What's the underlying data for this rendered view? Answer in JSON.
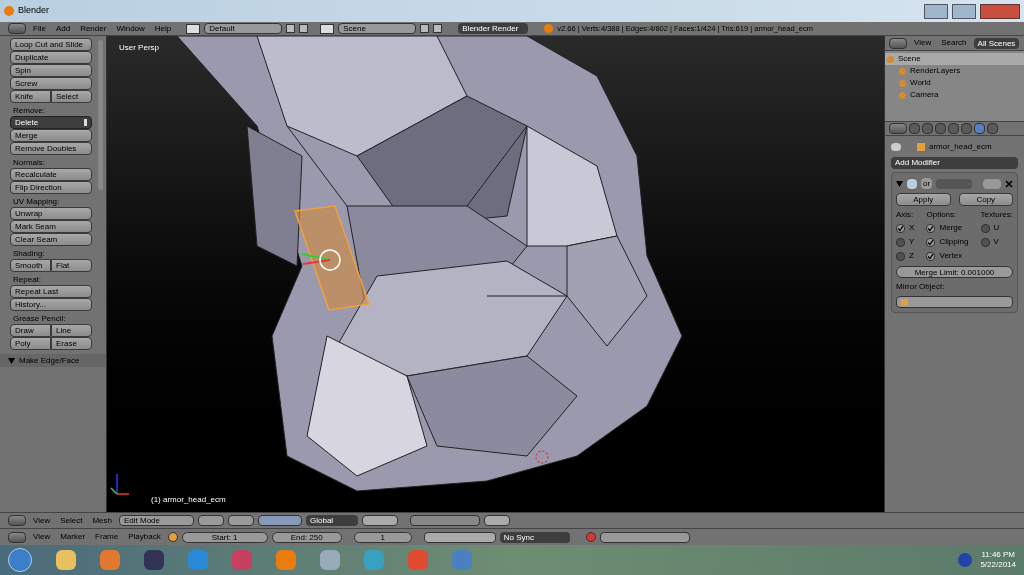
{
  "window": {
    "title": "Blender"
  },
  "info_header": {
    "menus": [
      "File",
      "Add",
      "Render",
      "Window",
      "Help"
    ],
    "layout": "Default",
    "scene": "Scene",
    "engine": "Blender Render",
    "stats": "v2.66 | Verts:4/388 | Edges:4/802 | Faces:1/424 | Tris:619 | armor_head_ecm"
  },
  "toolbar": [
    {
      "kind": "button",
      "label": "Loop Cut and Slide"
    },
    {
      "kind": "button",
      "label": "Duplicate"
    },
    {
      "kind": "button",
      "label": "Spin"
    },
    {
      "kind": "button",
      "label": "Screw"
    },
    {
      "kind": "pair",
      "labels": [
        "Knife",
        "Select"
      ]
    },
    {
      "kind": "label",
      "label": "Remove:"
    },
    {
      "kind": "dropdown",
      "label": "Delete"
    },
    {
      "kind": "button",
      "label": "Merge"
    },
    {
      "kind": "button",
      "label": "Remove Doubles"
    },
    {
      "kind": "label",
      "label": "Normals:"
    },
    {
      "kind": "button",
      "label": "Recalculate"
    },
    {
      "kind": "button",
      "label": "Flip Direction"
    },
    {
      "kind": "label",
      "label": "UV Mapping:"
    },
    {
      "kind": "button",
      "label": "Unwrap"
    },
    {
      "kind": "button",
      "label": "Mark Seam"
    },
    {
      "kind": "button",
      "label": "Clear Seam"
    },
    {
      "kind": "label",
      "label": "Shading:"
    },
    {
      "kind": "pair",
      "labels": [
        "Smooth",
        "Flat"
      ]
    },
    {
      "kind": "label",
      "label": "Repeat:"
    },
    {
      "kind": "button",
      "label": "Repeat Last"
    },
    {
      "kind": "button",
      "label": "History..."
    },
    {
      "kind": "label",
      "label": "Grease Pencil:"
    },
    {
      "kind": "pair",
      "labels": [
        "Draw",
        "Line"
      ]
    },
    {
      "kind": "pair",
      "labels": [
        "Poly",
        "Erase"
      ]
    }
  ],
  "last_operator": "Make Edge/Face",
  "viewport": {
    "view_name": "User Persp",
    "object_label": "(1) armor_head_ecm"
  },
  "outliner": {
    "menus": [
      "View",
      "Search"
    ],
    "filter": "All Scenes",
    "items": [
      {
        "label": "Scene",
        "selected": true,
        "children": [
          {
            "label": "RenderLayers",
            "selected": false
          },
          {
            "label": "World",
            "selected": false
          },
          {
            "label": "Camera",
            "selected": false
          }
        ]
      }
    ]
  },
  "properties": {
    "tabs": [
      {
        "selected": false
      },
      {
        "selected": false
      },
      {
        "selected": false
      },
      {
        "selected": false
      },
      {
        "selected": false
      },
      {
        "selected": true
      },
      {
        "selected": false
      }
    ],
    "object": "armor_head_ecm",
    "add_modifier": "Add Modifier",
    "modifier_name": "or",
    "apply": "Apply",
    "copy": "Copy",
    "columns": [
      {
        "title": "Axis:",
        "options": [
          {
            "label": "X",
            "checked": true
          },
          {
            "label": "Y",
            "checked": false
          },
          {
            "label": "Z",
            "checked": false
          }
        ]
      },
      {
        "title": "Options:",
        "options": [
          {
            "label": "Merge",
            "checked": true
          },
          {
            "label": "Clipping",
            "checked": true
          },
          {
            "label": "Vertex",
            "checked": true
          }
        ]
      },
      {
        "title": "Textures:",
        "options": [
          {
            "label": "U",
            "checked": false
          },
          {
            "label": "V",
            "checked": false
          }
        ]
      }
    ],
    "merge_limit": "Merge Limit: 0.001000",
    "mirror_object": "Mirror Object:"
  },
  "view3d_header": {
    "menus": [
      "View",
      "Select",
      "Mesh"
    ],
    "mode": "Edit Mode",
    "orientation": "Global"
  },
  "timeline_header": {
    "menus": [
      "View",
      "Marker",
      "Frame",
      "Playback"
    ],
    "start": "Start: 1",
    "end": "End: 250",
    "frame": "1",
    "sync": "No Sync"
  },
  "taskbar": {
    "time": "11:46 PM",
    "date": "5/22/2014"
  }
}
